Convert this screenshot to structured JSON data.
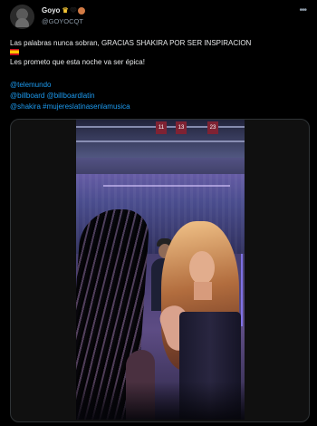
{
  "tweet": {
    "name": "Goyo",
    "handle": "@GOYOCQT",
    "line1": "Las palabras nunca sobran, GRACIAS SHAKIRA POR SER INSPIRACION",
    "line2": "Les prometo que esta noche  va ser épica!",
    "links": [
      "@telemundo",
      "@billboard @billboardlatin",
      "@shakira #mujereslatinasenlamusica"
    ],
    "more_label": "•••"
  },
  "media": {
    "banners": [
      "11",
      "13",
      "23"
    ]
  },
  "icons": {
    "avatar": "avatar-icon",
    "more": "more-options-icon",
    "flag": "spain-flag-icon",
    "crown": "crown-emoji-icon",
    "heart": "black-heart-emoji-icon",
    "ball": "brown-circle-emoji-icon"
  },
  "colors": {
    "background": "#000000",
    "text": "#e7e9ea",
    "muted": "#8b98a5",
    "link": "#1d9bf0"
  }
}
